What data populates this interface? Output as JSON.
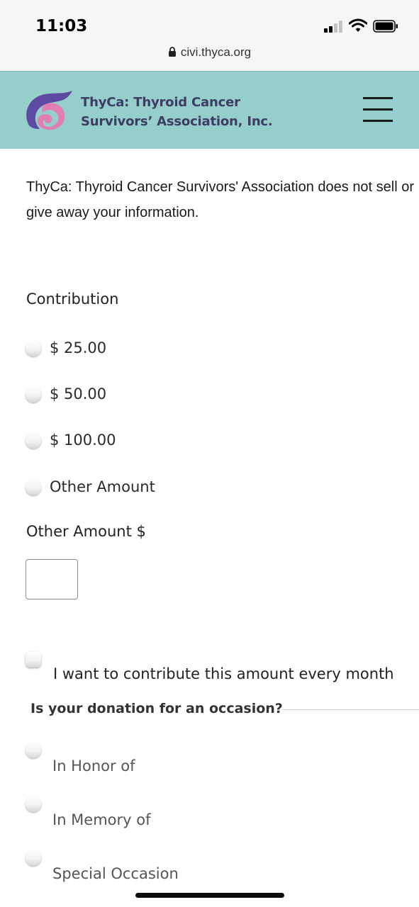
{
  "status_bar": {
    "time": "11:03",
    "icons": [
      "signal-icon",
      "wifi-icon",
      "battery-icon"
    ]
  },
  "browser": {
    "url": "civi.thyca.org",
    "lock_icon": "lock-icon"
  },
  "header": {
    "logo_line1": "ThyCa: Thyroid Cancer",
    "logo_line2": "Survivors’ Association, Inc.",
    "menu_icon": "hamburger-menu-icon",
    "background_color": "#95cecb",
    "logo_colors": [
      "#5b4aa0",
      "#e27fb0"
    ]
  },
  "notice": "ThyCa: Thyroid Cancer Survivors' Association does not sell or give away your information.",
  "contribution": {
    "label": "Contribution",
    "options": [
      {
        "label": "$ 25.00",
        "selected": false
      },
      {
        "label": "$ 50.00",
        "selected": false
      },
      {
        "label": "$ 100.00",
        "selected": false
      },
      {
        "label": "Other Amount",
        "selected": false
      }
    ],
    "other_amount_label": "Other Amount $",
    "other_amount_value": ""
  },
  "recurring": {
    "label": "I want to contribute this amount every month",
    "checked": false
  },
  "occasion": {
    "legend": "Is your donation for an occasion?",
    "options": [
      {
        "label": "In Honor of",
        "selected": false
      },
      {
        "label": "In Memory of",
        "selected": false
      },
      {
        "label": "Special Occasion",
        "selected": false
      }
    ]
  }
}
